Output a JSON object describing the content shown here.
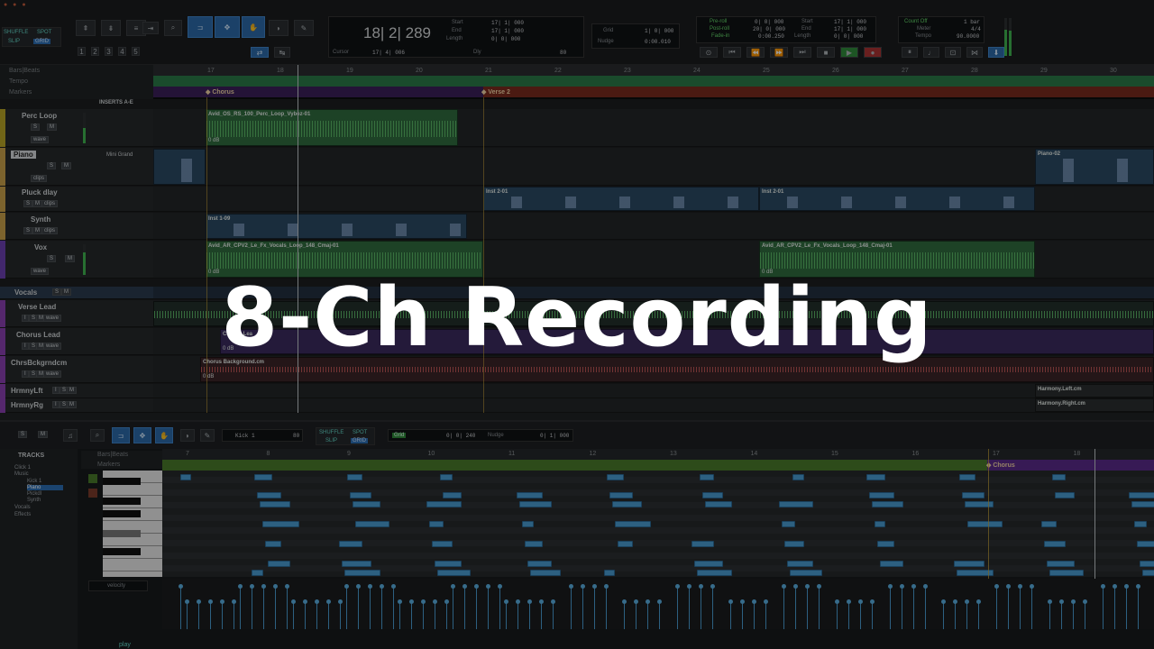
{
  "overlay": {
    "title": "8-Ch Recording"
  },
  "transport": {
    "modes": {
      "shuffle": "SHUFFLE",
      "spot": "SPOT",
      "slip": "SLIP",
      "grid": "GRID"
    },
    "counter_main": "18| 2| 289",
    "start_label": "Start",
    "end_label": "End",
    "length_label": "Length",
    "start_value": "17| 1| 000",
    "end_value": "17| 1| 000",
    "length_value": "0| 0| 000",
    "cursor_label": "Cursor",
    "cursor_value": "17| 4| 006",
    "dly_label": "Dly",
    "dly_value": "80",
    "grid_label": "Grid",
    "grid_value": "1| 0| 000",
    "nudge_label": "Nudge",
    "nudge_value": "0:00.010",
    "preroll_label": "Pre-roll",
    "postroll_label": "Post-roll",
    "fadein_label": "Fade-in",
    "preroll_value": "0| 0| 000",
    "postroll_value": "20| 0| 000",
    "fadein_value": "0:00.250",
    "start2_value": "17| 1| 000",
    "end2_value": "17| 1| 000",
    "length2_value": "0| 0| 000",
    "countoff_label": "Count Off",
    "countoff_value": "1 bar",
    "meter_label": "Meter",
    "meter_value": "4/4",
    "tempo_label": "Tempo",
    "tempo_value": "90.0000",
    "numbers": [
      "1",
      "2",
      "3",
      "4",
      "5"
    ]
  },
  "rulers": {
    "bars_label": "Bars|Beats",
    "tempo_label": "Tempo",
    "markers_label": "Markers",
    "bar_numbers": [
      "17",
      "18",
      "19",
      "20",
      "21",
      "22",
      "23",
      "24",
      "25",
      "26",
      "27",
      "28",
      "29",
      "30"
    ],
    "marker_chorus": "Chorus",
    "marker_verse2": "Verse 2",
    "inserts_label": "INSERTS A-E"
  },
  "tracks": [
    {
      "name": "Perc Loop",
      "color": "#b7a326",
      "insert": "",
      "clip1": "Avid_OS_RS_100_Perc_Loop_Vybez-01",
      "clip1_db": "0 dB"
    },
    {
      "name": "Piano",
      "color": "#c9a04a",
      "insert": "Mini Grand",
      "clip1": "Piano-02"
    },
    {
      "name": "Pluck dlay",
      "color": "#c9a04a",
      "clip1": "Inst 2-01",
      "clip2": "Inst 2-01"
    },
    {
      "name": "Synth",
      "color": "#c9a04a",
      "clip1": "Inst 1-09"
    },
    {
      "name": "Vox",
      "color": "#6b3fb0",
      "clip1": "Avid_AR_CPV2_Le_Fx_Vocals_Loop_148_Cmaj-01",
      "clip2": "Avid_AR_CPV2_Le_Fx_Vocals_Loop_148_Cmaj-01",
      "clip1_db": "0 dB",
      "clip2_db": "0 dB"
    },
    {
      "name": "Vocals",
      "color": "#6b3fb0"
    },
    {
      "name": "Verse Lead",
      "color": "#8a3fb0"
    },
    {
      "name": "Chorus Lead",
      "color": "#8a3fb0",
      "clip1": "Chorus Lea",
      "clip1_db": "0 dB"
    },
    {
      "name": "ChrsBckgrndcm",
      "color": "#8a3fb0",
      "clip1": "Chorus Background.cm",
      "clip1_db": "0 dB"
    },
    {
      "name": "HrmnyLft",
      "color": "#8a3fb0",
      "clip1": "Harmony.Left.cm"
    },
    {
      "name": "HrmnyRg",
      "color": "#8a3fb0",
      "clip1": "Harmony.Right.cm"
    }
  ],
  "track_buttons": {
    "solo": "S",
    "mute": "M",
    "input": "I",
    "wave": "wave",
    "clips": "clips",
    "read": "read",
    "dyn": "dyn"
  },
  "editor": {
    "tracks_label": "TRACKS",
    "s": "S",
    "m": "M",
    "track_list": [
      "Click 1",
      "Music",
      "Kick 1",
      "Piano",
      "Pickdl",
      "Synth",
      "Vocals",
      "Effects"
    ],
    "kick_sel": "Kick 1",
    "kick_val": "80",
    "shuffle": "SHUFFLE",
    "spot": "SPOT",
    "slip": "SLIP",
    "grid": "GRID",
    "grid_label": "Grid",
    "grid_value": "0| 0| 240",
    "nudge_label": "Nudge",
    "nudge_value": "0| 1| 000",
    "bars_label": "Bars|Beats",
    "markers_label": "Markers",
    "marker_chorus": "Chorus",
    "bar_numbers": [
      "7",
      "8",
      "9",
      "10",
      "11",
      "12",
      "13",
      "14",
      "15",
      "16",
      "17",
      "18"
    ],
    "velocity_label": "velocity",
    "play_label": "play"
  }
}
